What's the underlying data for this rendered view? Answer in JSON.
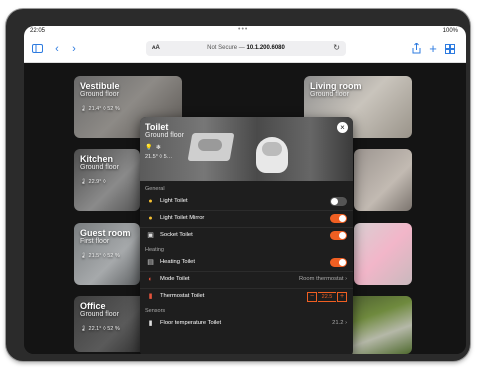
{
  "status_bar": {
    "time": "22:05",
    "dots": "•••",
    "battery": "100%"
  },
  "browser": {
    "text_size_label": "ᴀA",
    "security": "Not Secure —",
    "url": "10.1.200.6080",
    "icons": {
      "sidebar": "sidebar-icon",
      "back": "back-icon",
      "forward": "forward-icon",
      "reload": "reload-icon",
      "share": "share-icon",
      "new_tab": "plus-icon",
      "tabs": "tabs-icon"
    }
  },
  "rooms": [
    {
      "name": "Vestibule",
      "floor": "Ground floor",
      "temp": "21.4°",
      "humidity": "52 %"
    },
    {
      "name": "Living room",
      "floor": "Ground floor"
    },
    {
      "name": "Kitchen",
      "floor": "Ground floor",
      "temp": "22.9°",
      "humidity": ""
    },
    {
      "name": "Guest room",
      "floor": "First floor",
      "temp": "21.5°",
      "humidity": "52 %"
    },
    {
      "name": "Office",
      "floor": "Ground floor",
      "temp": "22.1°",
      "humidity": "52 %"
    }
  ],
  "modal": {
    "title": "Toilet",
    "floor": "Ground floor",
    "stats": "21.5°  ◊ 5…",
    "close_label": "×",
    "sections": {
      "general": "General",
      "heating": "Heating",
      "sensors": "Sensors"
    },
    "rows": {
      "light_toilet": {
        "label": "Light Toilet",
        "state": "off"
      },
      "light_mirror": {
        "label": "Light Toilet Mirror",
        "state": "on"
      },
      "socket": {
        "label": "Socket Toilet",
        "state": "on"
      },
      "heating": {
        "label": "Heating Toilet",
        "state": "on"
      },
      "mode": {
        "label": "Mode Toilet",
        "value": "Room thermostat ›"
      },
      "thermostat": {
        "label": "Thermostat Toilet",
        "value": "22.5",
        "minus": "−",
        "plus": "+"
      },
      "floor_temp": {
        "label": "Floor temperature Toilet",
        "value": "21.2 ›"
      }
    }
  },
  "colors": {
    "accent": "#f05f22",
    "browser_blue": "#2d7be0",
    "background": "#141414"
  }
}
